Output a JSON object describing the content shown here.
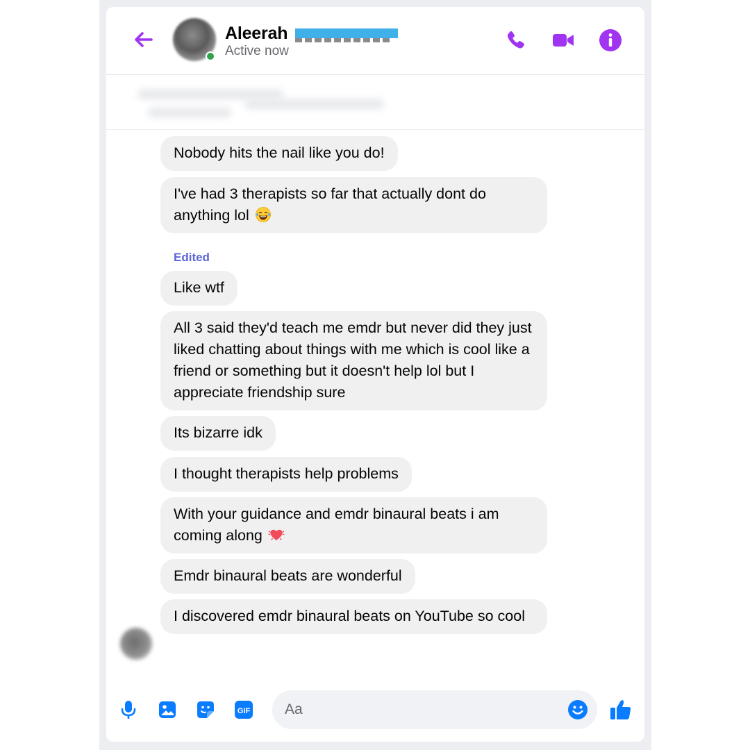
{
  "header": {
    "contact_name": "Aleerah",
    "status": "Active now",
    "icons": [
      "back-arrow-icon",
      "phone-icon",
      "video-camera-icon",
      "info-icon"
    ]
  },
  "accent_color": "#a034f0",
  "messages": [
    {
      "text": "Nobody hits the nail like you do!"
    },
    {
      "text": "I've had 3 therapists so far that actually dont do anything lol",
      "emoji": "laughing-tears-emoji"
    },
    {
      "label": "Edited",
      "text": "Like wtf"
    },
    {
      "text": "All 3 said they'd teach me emdr but never did they just liked chatting about things with me which is cool like a friend or something but it doesn't help lol but I appreciate friendship sure"
    },
    {
      "text": "Its bizarre idk"
    },
    {
      "text": "I thought therapists help problems"
    },
    {
      "text": "With your guidance and emdr binaural beats i am coming along",
      "emoji": "beating-heart-emoji"
    },
    {
      "text": "Emdr binaural beats are wonderful"
    },
    {
      "text": "I discovered emdr binaural beats on YouTube so cool"
    }
  ],
  "composer": {
    "placeholder": "Aa",
    "tools": [
      "microphone-icon",
      "image-icon",
      "sticker-icon",
      "gif-icon"
    ],
    "gif_label": "GIF",
    "send_icon": "thumbs-up-icon"
  },
  "colors": {
    "bubble": "#f0f0f0",
    "edited_label": "#5b64d9",
    "composer_icons": "#0a7cff",
    "online": "#31a24c"
  }
}
